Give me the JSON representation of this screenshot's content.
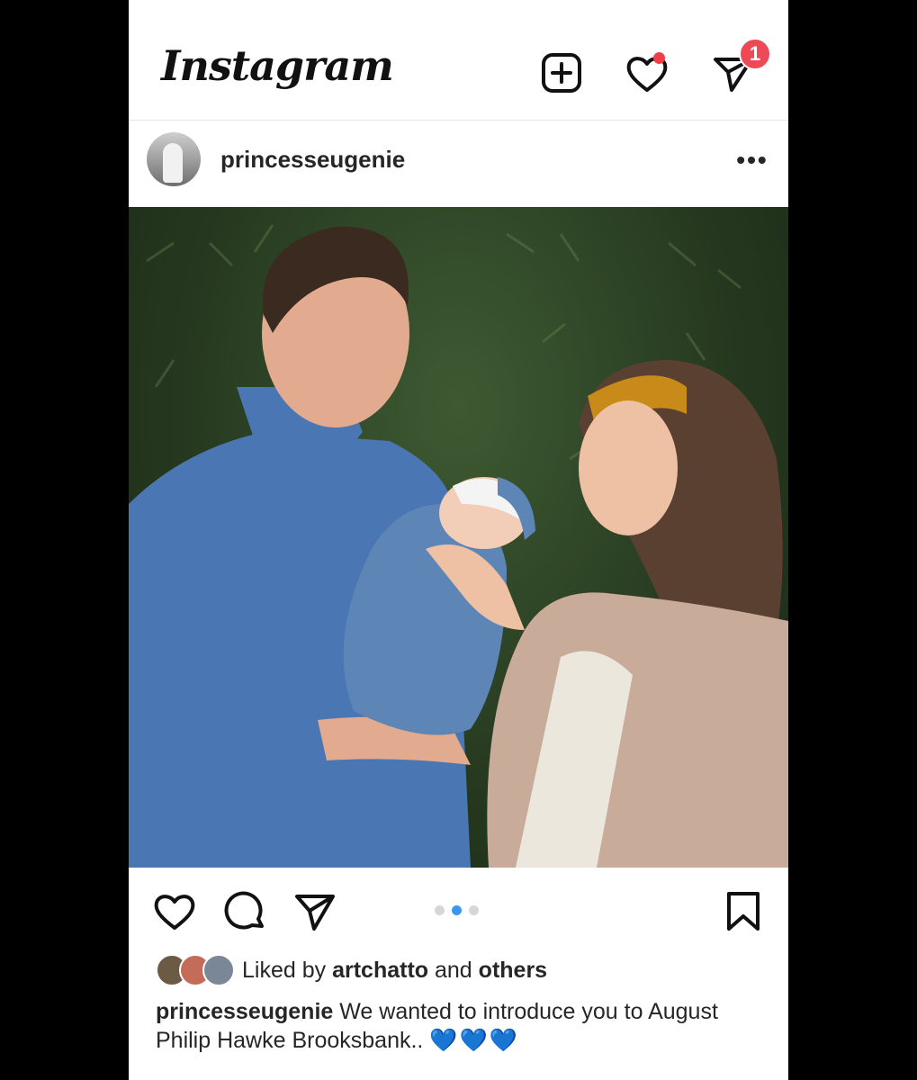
{
  "header": {
    "app_logo": "Instagram",
    "icons": [
      "new-post-icon",
      "activity-heart-icon",
      "direct-message-icon"
    ],
    "direct_badge": "1",
    "accent_colors": {
      "badge": "#ed4956",
      "active_dot": "#3897f0"
    }
  },
  "post": {
    "username": "princesseugenie",
    "more_label": "•••",
    "carousel": {
      "count": 3,
      "active": 2
    },
    "likes": {
      "prefix": "Liked by",
      "user": "artchatto",
      "middle": "and",
      "suffix": "others"
    },
    "caption": {
      "username": "princesseugenie",
      "text": "We wanted to introduce you to August Philip Hawke Brooksbank..",
      "emoji": "💙💙💙"
    }
  }
}
